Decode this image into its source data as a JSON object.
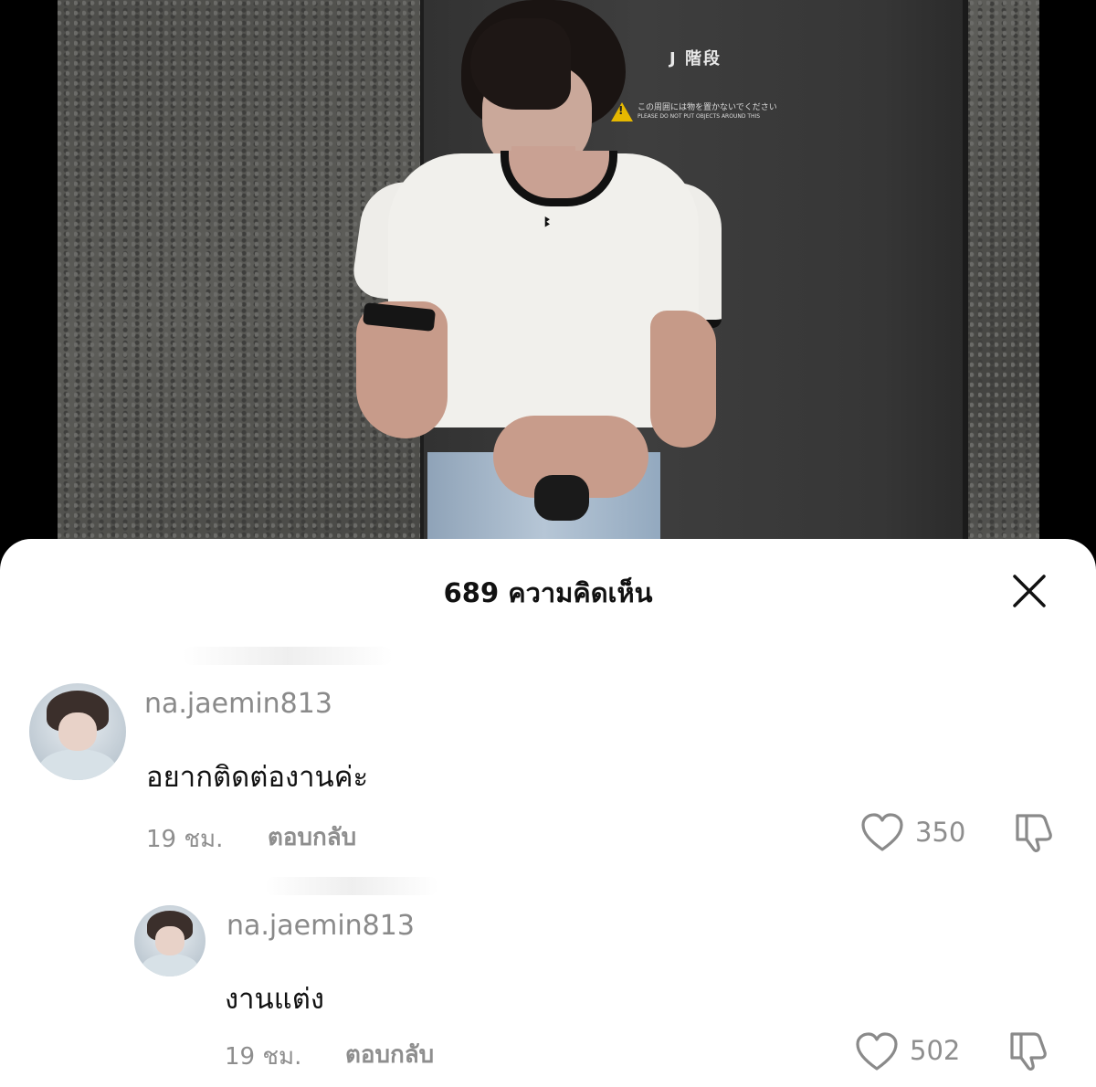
{
  "photo": {
    "door_sign": "J 階段",
    "warning_jp": "この周囲には物を置かないでください",
    "warning_en": "PLEASE DO NOT PUT OBJECTS AROUND THIS"
  },
  "sheet": {
    "title": "689 ความคิดเห็น"
  },
  "comments": [
    {
      "username": "na.jaemin813",
      "text": "อยากติดต่องานค่ะ",
      "time": "19 ชม.",
      "reply_label": "ตอบกลับ",
      "likes": "350"
    },
    {
      "username": "na.jaemin813",
      "text": "งานแต่ง",
      "time": "19 ชม.",
      "reply_label": "ตอบกลับ",
      "likes": "502"
    }
  ],
  "icons": {
    "close": "close-icon",
    "like": "heart-outline-icon",
    "dislike": "thumbs-down-icon"
  },
  "colors": {
    "sheet_bg": "#ffffff",
    "secondary_text": "#8e8e8e",
    "primary_text": "#111111"
  }
}
